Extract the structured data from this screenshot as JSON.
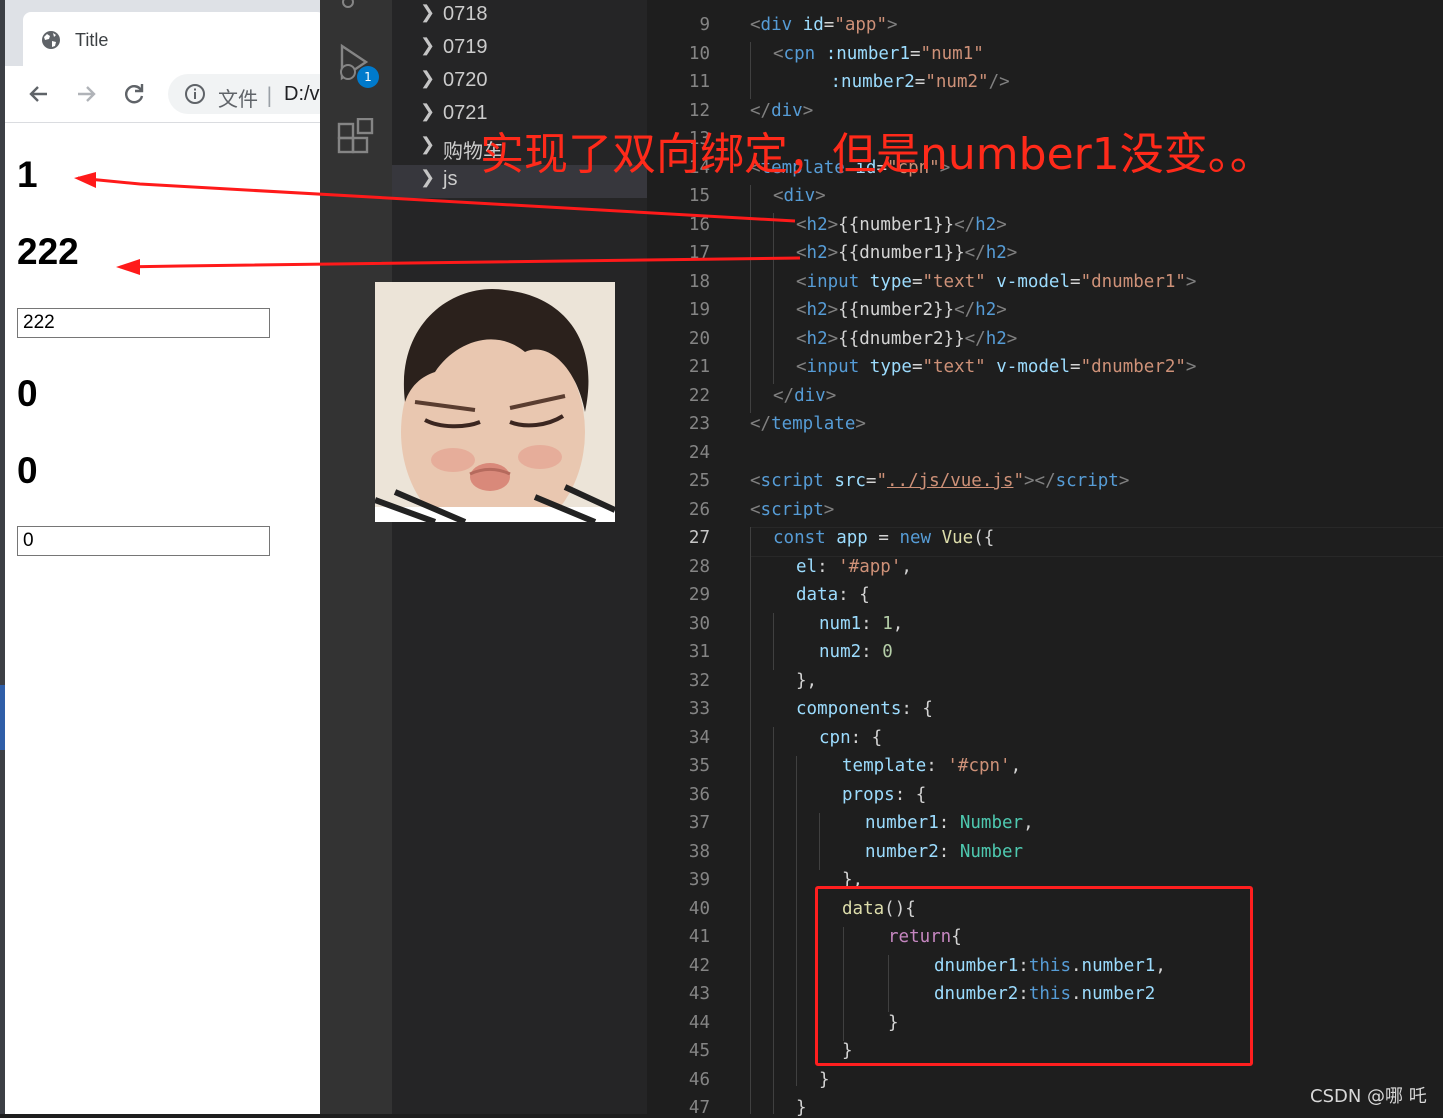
{
  "browser": {
    "tab_title": "Title",
    "address": {
      "scheme_label": "文件",
      "separator": "|",
      "path": "D:/v"
    },
    "app": {
      "h2_number1": "1",
      "h2_dnumber1": "222",
      "input_dnumber1": "222",
      "h2_number2": "0",
      "h2_dnumber2": "0",
      "input_dnumber2": "0"
    }
  },
  "activity_bar": {
    "run_debug_badge": "1"
  },
  "explorer": {
    "items": [
      {
        "label": "0718"
      },
      {
        "label": "0719"
      },
      {
        "label": "0720"
      },
      {
        "label": "0721"
      },
      {
        "label": "购物车"
      },
      {
        "label": "js"
      }
    ]
  },
  "editor": {
    "current_line": 27,
    "lines": [
      {
        "n": "9"
      },
      {
        "n": "10"
      },
      {
        "n": "11"
      },
      {
        "n": "12"
      },
      {
        "n": "13"
      },
      {
        "n": "14"
      },
      {
        "n": "15"
      },
      {
        "n": "16"
      },
      {
        "n": "17"
      },
      {
        "n": "18"
      },
      {
        "n": "19"
      },
      {
        "n": "20"
      },
      {
        "n": "21"
      },
      {
        "n": "22"
      },
      {
        "n": "23"
      },
      {
        "n": "24"
      },
      {
        "n": "25"
      },
      {
        "n": "26"
      },
      {
        "n": "27"
      },
      {
        "n": "28"
      },
      {
        "n": "29"
      },
      {
        "n": "30"
      },
      {
        "n": "31"
      },
      {
        "n": "32"
      },
      {
        "n": "33"
      },
      {
        "n": "34"
      },
      {
        "n": "35"
      },
      {
        "n": "36"
      },
      {
        "n": "37"
      },
      {
        "n": "38"
      },
      {
        "n": "39"
      },
      {
        "n": "40"
      },
      {
        "n": "41"
      },
      {
        "n": "42"
      },
      {
        "n": "43"
      },
      {
        "n": "44"
      },
      {
        "n": "45"
      },
      {
        "n": "46"
      },
      {
        "n": "47"
      }
    ],
    "code": {
      "l9": [
        "<",
        "div",
        " ",
        "id",
        "=",
        "\"app\"",
        ">"
      ],
      "l10": [
        "<",
        "cpn",
        " ",
        ":number1",
        "=",
        "\"num1\""
      ],
      "l11": [
        ":number2",
        "=",
        "\"num2\"",
        "/>"
      ],
      "l12": [
        "</",
        "div",
        ">"
      ],
      "l14": [
        "<",
        "template",
        " ",
        "id",
        "=",
        "\"cpn\"",
        ">"
      ],
      "l15": [
        "<",
        "div",
        ">"
      ],
      "l16": [
        "<",
        "h2",
        ">",
        "{{number1}}",
        "</",
        "h2",
        ">"
      ],
      "l17": [
        "<",
        "h2",
        ">",
        "{{dnumber1}}",
        "</",
        "h2",
        ">"
      ],
      "l18": [
        "<",
        "input",
        " ",
        "type",
        "=",
        "\"text\"",
        " ",
        "v-model",
        "=",
        "\"dnumber1\"",
        ">"
      ],
      "l19": [
        "<",
        "h2",
        ">",
        "{{number2}}",
        "</",
        "h2",
        ">"
      ],
      "l20": [
        "<",
        "h2",
        ">",
        "{{dnumber2}}",
        "</",
        "h2",
        ">"
      ],
      "l21": [
        "<",
        "input",
        " ",
        "type",
        "=",
        "\"text\"",
        " ",
        "v-model",
        "=",
        "\"dnumber2\"",
        ">"
      ],
      "l22": [
        "</",
        "div",
        ">"
      ],
      "l23": [
        "</",
        "template",
        ">"
      ],
      "l25": [
        "<",
        "script",
        " ",
        "src",
        "=",
        "\"",
        "../js/vue.js",
        "\"",
        "></",
        "script",
        ">"
      ],
      "l26": [
        "<",
        "script",
        ">"
      ],
      "l27": [
        "const",
        " ",
        "app",
        " = ",
        "new",
        " ",
        "Vue",
        "(",
        "{"
      ],
      "l28": [
        "el",
        ": ",
        "'#app'",
        ","
      ],
      "l29": [
        "data",
        ": {"
      ],
      "l30": [
        "num1",
        ": ",
        "1",
        ","
      ],
      "l31": [
        "num2",
        ": ",
        "0"
      ],
      "l32": [
        "},"
      ],
      "l33": [
        "components",
        ": {"
      ],
      "l34": [
        "cpn",
        ": {"
      ],
      "l35": [
        "template",
        ": ",
        "'#cpn'",
        ","
      ],
      "l36": [
        "props",
        ": {"
      ],
      "l37": [
        "number1",
        ": ",
        "Number",
        ","
      ],
      "l38": [
        "number2",
        ": ",
        "Number"
      ],
      "l39": [
        "},"
      ],
      "l40": [
        "data",
        "(){"
      ],
      "l41": [
        "return",
        "{"
      ],
      "l42": [
        "dnumber1",
        ":",
        "this",
        ".",
        "number1",
        ","
      ],
      "l43": [
        "dnumber2",
        ":",
        "this",
        ".",
        "number2"
      ],
      "l44": [
        "}"
      ],
      "l45": [
        "}"
      ],
      "l46": [
        "}"
      ],
      "l47": [
        "}"
      ]
    }
  },
  "annotation": {
    "text": "实现了双向绑定，但是number1没变。。",
    "color": "#ff2a1a"
  },
  "watermark": "CSDN @哪 吒",
  "colors": {
    "arrow": "#ff1a1a",
    "highlight_box": "#ff1f1f",
    "editor_bg": "#1e1e1e",
    "sidebar_bg": "#252526",
    "activity_bg": "#333333"
  }
}
